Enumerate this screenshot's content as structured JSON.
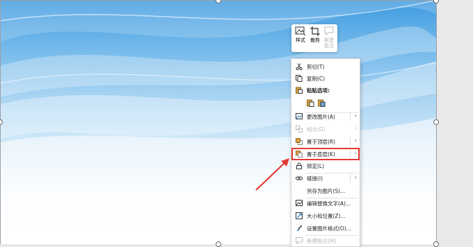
{
  "mini_toolbar": {
    "style_label": "样式",
    "crop_label": "裁剪",
    "new_comment_label": "新建\n批注"
  },
  "context_menu": {
    "items": {
      "cut": "剪切(T)",
      "copy": "复制(C)",
      "paste_options": "粘贴选项:",
      "change_picture": "更改图片(A)",
      "group": "组合(G)",
      "bring_to_front": "置于顶层(R)",
      "send_to_back": "置于底层(K)",
      "lock": "锁定(L)",
      "link": "链接(I)",
      "save_as_picture": "另存为图片(S)...",
      "edit_alt_text": "编辑替换文字(A)...",
      "size_position": "大小和位置(Z)...",
      "format_picture": "设置图片格式(O)...",
      "new_comment": "新建批注(M)"
    }
  },
  "colors": {
    "highlight_border": "#e53935",
    "annotation_arrow": "#e53935"
  }
}
